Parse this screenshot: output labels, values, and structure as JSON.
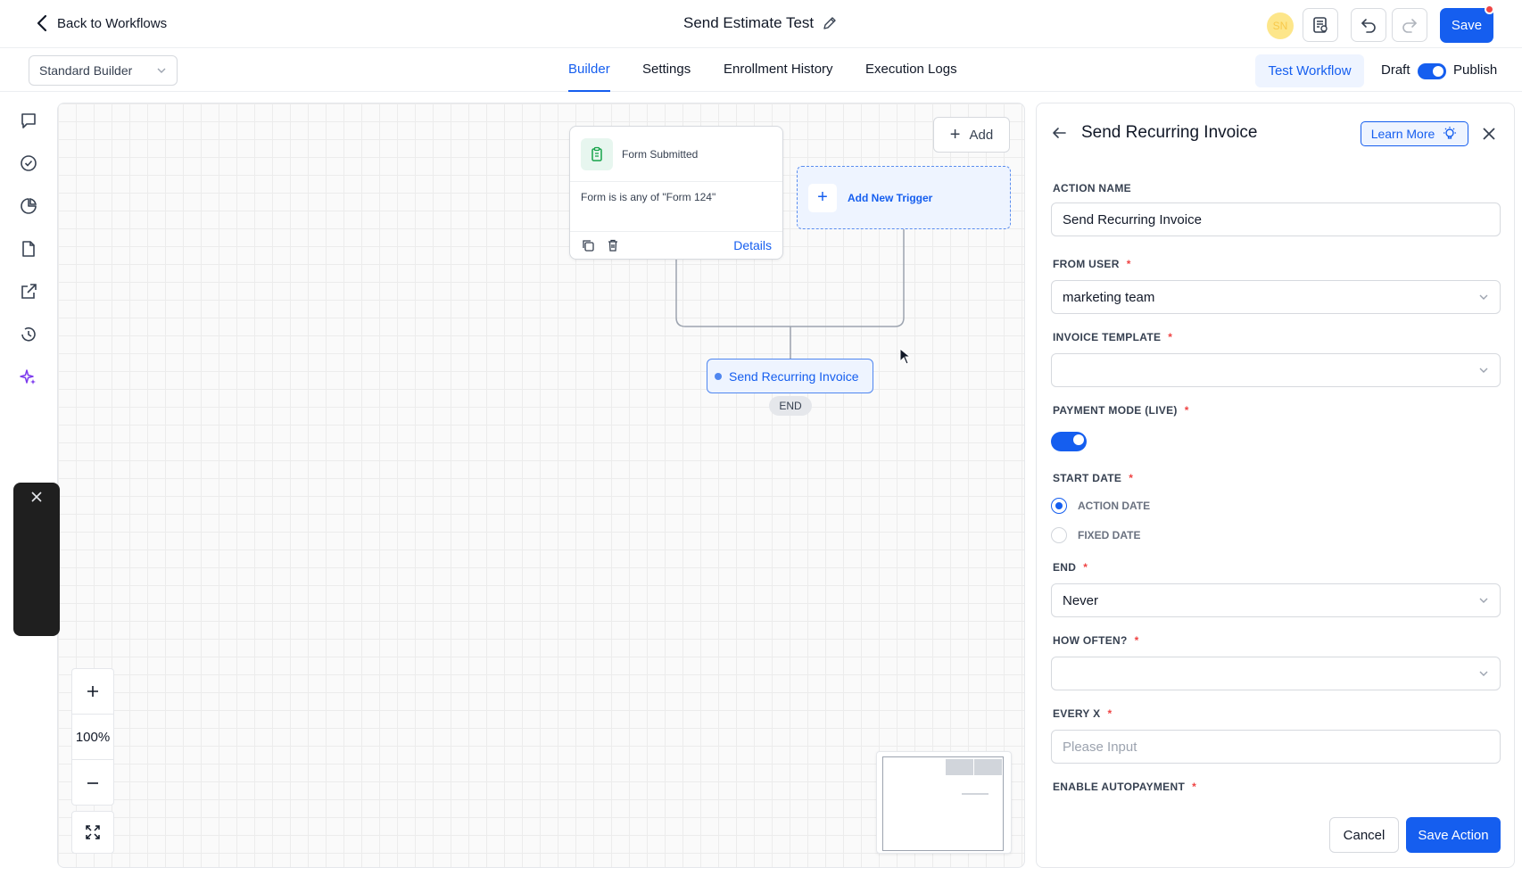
{
  "header": {
    "back_label": "Back to Workflows",
    "workflow_title": "Send Estimate Test",
    "avatar_initials": "SN",
    "save_label": "Save"
  },
  "subnav": {
    "builder_select": "Standard Builder",
    "tabs": [
      {
        "label": "Builder",
        "active": true
      },
      {
        "label": "Settings",
        "active": false
      },
      {
        "label": "Enrollment History",
        "active": false
      },
      {
        "label": "Execution Logs",
        "active": false
      }
    ],
    "test_workflow_label": "Test Workflow",
    "draft_label": "Draft",
    "publish_label": "Publish",
    "publish_on": true
  },
  "canvas": {
    "add_label": "Add",
    "trigger": {
      "title": "Form Submitted",
      "condition": "Form is is any of \"Form 124\"",
      "details_label": "Details"
    },
    "add_new_trigger_label": "Add New Trigger",
    "action_node_label": "Send Recurring Invoice",
    "end_label": "END",
    "zoom_level": "100%"
  },
  "panel": {
    "title": "Send Recurring Invoice",
    "learn_more_label": "Learn More",
    "fields": {
      "action_name": {
        "label": "ACTION NAME",
        "value": "Send Recurring Invoice"
      },
      "from_user": {
        "label": "FROM USER",
        "value": "marketing team"
      },
      "invoice_template": {
        "label": "INVOICE TEMPLATE",
        "value": ""
      },
      "payment_mode": {
        "label": "PAYMENT MODE (LIVE)",
        "on": true
      },
      "start_date": {
        "label": "START DATE",
        "options": [
          "ACTION DATE",
          "FIXED DATE"
        ],
        "selected": "ACTION DATE"
      },
      "end": {
        "label": "END",
        "value": "Never"
      },
      "how_often": {
        "label": "HOW OFTEN?",
        "value": ""
      },
      "every_x": {
        "label": "EVERY X",
        "placeholder": "Please Input"
      },
      "enable_autopayment": {
        "label": "ENABLE AUTOPAYMENT"
      }
    },
    "required_mark": "*",
    "cancel_label": "Cancel",
    "save_action_label": "Save Action"
  },
  "colors": {
    "primary": "#155eef",
    "required": "#ef4444",
    "trigger_icon_bg": "#e7f6ef"
  }
}
